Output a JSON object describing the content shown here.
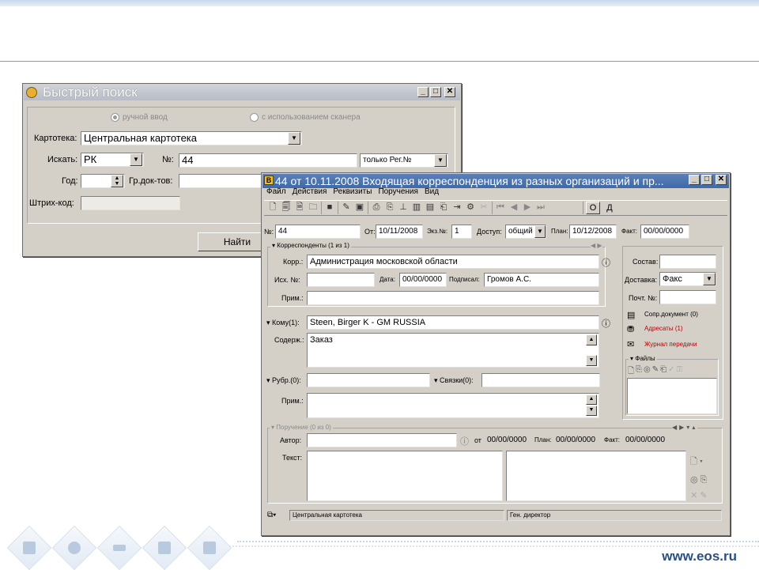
{
  "footer": {
    "url": "www.eos.ru"
  },
  "search_window": {
    "title": "Быстрый поиск",
    "radio_manual": "ручной ввод",
    "radio_scanner": "с использованием сканера",
    "cardfile_label": "Картотека:",
    "cardfile_value": "Центральная картотека",
    "search_label": "Искать:",
    "search_value": "РК",
    "number_label": "№:",
    "number_value": "44",
    "scope_value": "только Рег.№",
    "year_label": "Год:",
    "year_value": "",
    "doc_group_label": "Гр.док-тов:",
    "doc_group_value": "",
    "barcode_label": "Штрих-код:",
    "barcode_value": "",
    "find_button": "Найти"
  },
  "doc_window": {
    "title": "44 от 10.11.2008 Входящая корреспонденция из разных организаций и пр...",
    "menu": [
      "Файл",
      "Действия",
      "Реквизиты",
      "Поручения",
      "Вид"
    ],
    "toolbar_tail": [
      "О",
      "Д"
    ],
    "num_label": "№:",
    "num_value": "44",
    "from_label": "От:",
    "from_value": "10/11/2008",
    "copies_label": "Экз.№:",
    "copies_value": "1",
    "access_label": "Доступ:",
    "access_value": "общий",
    "plan_label": "План:",
    "plan_value": "10/12/2008",
    "fact_label": "Факт:",
    "fact_value": "00/00/0000",
    "correspondents": {
      "header": "Корреспонденты (1 из 1)",
      "corr_label": "Корр.:",
      "corr_value": "Администрация московской области",
      "out_no_label": "Исх. №:",
      "out_no_value": "",
      "date_label": "Дата:",
      "date_value": "00/00/0000",
      "signed_label": "Подписал:",
      "signed_value": "Громов А.С.",
      "note_label": "Прим.:",
      "note_value": ""
    },
    "to_label": "Кому(1):",
    "to_value": "Steen, Birger K - GM RUSSIA",
    "content_label": "Содерж.:",
    "content_value": "Заказ",
    "rubric_label": "Рубр.(0):",
    "rubric_value": "",
    "links_label": "Связки(0):",
    "links_value": "",
    "note2_label": "Прим.:",
    "note2_value": "",
    "right_panel": {
      "composition_label": "Состав:",
      "composition_value": "",
      "delivery_label": "Доставка:",
      "delivery_value": "Факс",
      "post_no_label": "Почт. №:",
      "post_no_value": "",
      "accompany_doc": "Сопр.документ (0)",
      "addressees": "Адресаты (1)",
      "transfer_log": "Журнал передачи",
      "files_header": "Файлы"
    },
    "assignment": {
      "header": "Поручение (0 из 0)",
      "author_label": "Автор:",
      "author_value": "",
      "from_label": "от",
      "from_value": "00/00/0000",
      "plan_label": "План:",
      "plan_value": "00/00/0000",
      "fact_label": "Факт:",
      "fact_value": "00/00/0000",
      "text_label": "Текст:"
    },
    "status": {
      "cardfile": "Центральная картотека",
      "role": "Ген. директор"
    }
  },
  "colors": {
    "title_active": "#3e6aa8",
    "title_inactive": "#b7bcc6",
    "window_bg": "#d4d0c8",
    "red_link": "#c00000",
    "footer_url": "#2a4f86"
  }
}
